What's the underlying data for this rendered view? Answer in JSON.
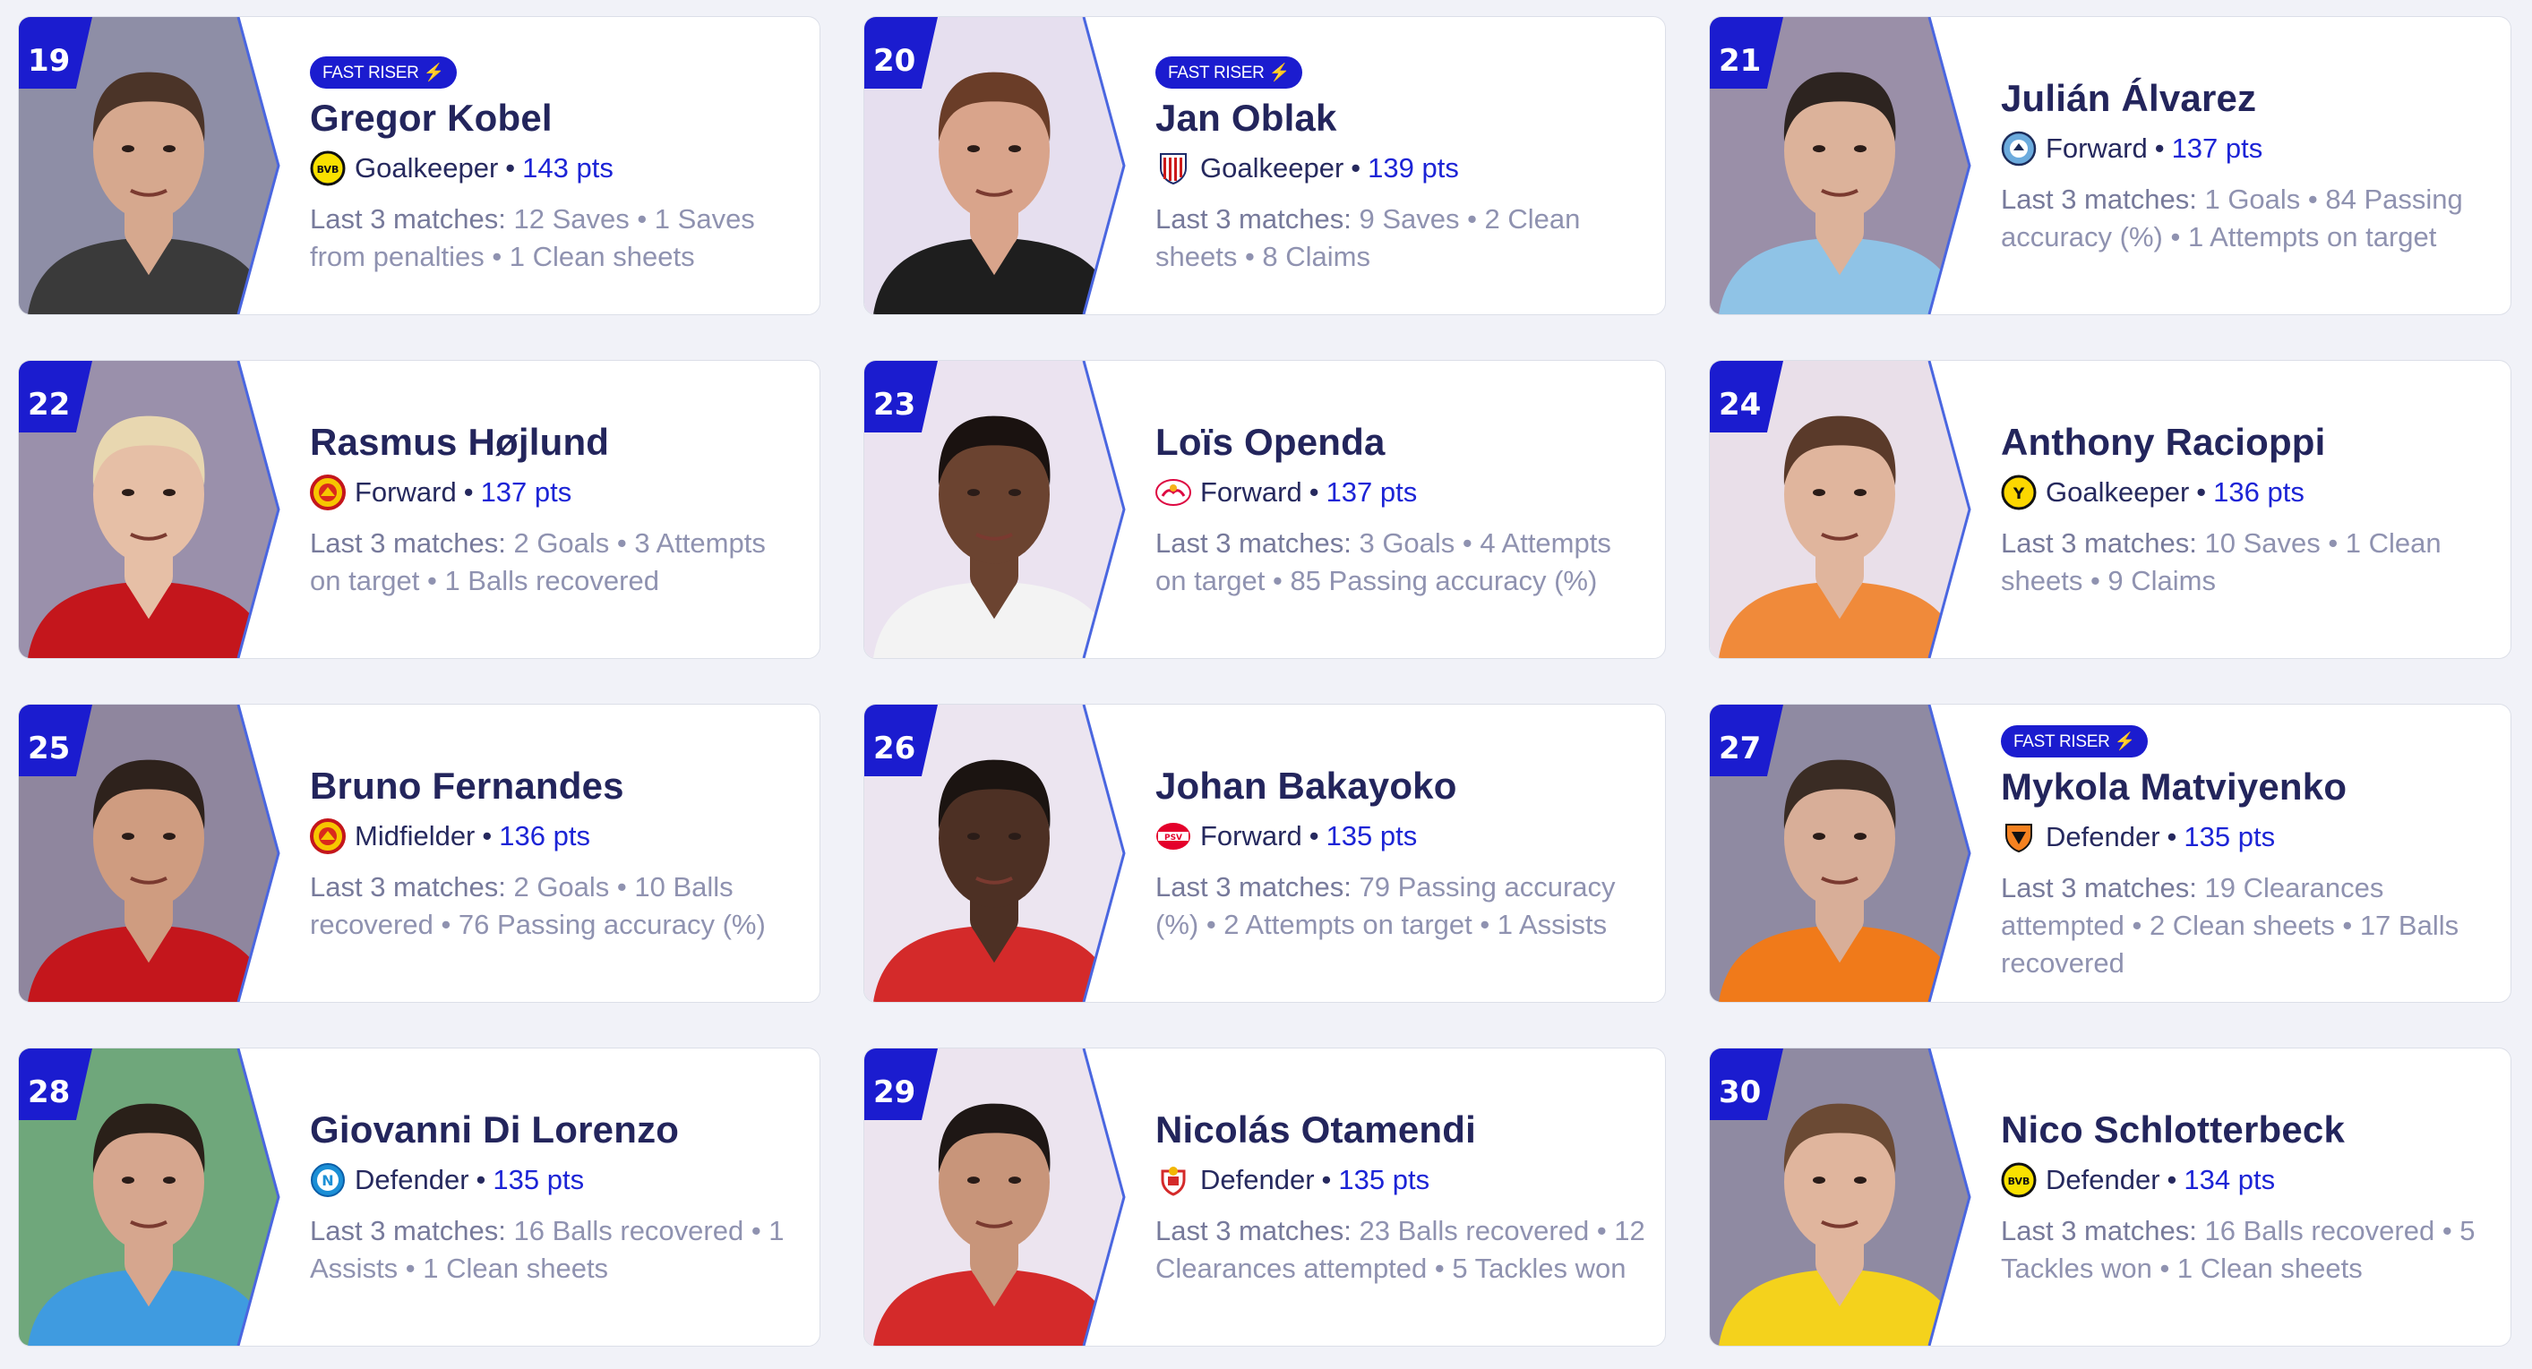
{
  "labels": {
    "fast_riser": "FAST RISER ⚡",
    "last3": "Last 3 matches:",
    "sep": " • "
  },
  "players": [
    {
      "rank": "19",
      "name": "Gregor Kobel",
      "position": "Goalkeeper",
      "pts": "143 pts",
      "fast": true,
      "club": "dortmund",
      "stats": "12 Saves • 1 Saves from penalties • 1 Clean sheets",
      "bg": "#8e8ea6",
      "skin": "#d6a88e",
      "hair": "#4b3428",
      "shirt": "#3a3a3a"
    },
    {
      "rank": "20",
      "name": "Jan Oblak",
      "position": "Goalkeeper",
      "pts": "139 pts",
      "fast": true,
      "club": "atletico",
      "stats": "9 Saves • 2 Clean sheets • 8 Claims",
      "bg": "#e6dfef",
      "skin": "#d9a48b",
      "hair": "#6a3d28",
      "shirt": "#1e1e1e"
    },
    {
      "rank": "21",
      "name": "Julián Álvarez",
      "position": "Forward",
      "pts": "137 pts",
      "fast": false,
      "club": "mancity",
      "stats": "1 Goals • 84 Passing accuracy (%) • 1 Attempts on target",
      "bg": "#9a8fa8",
      "skin": "#dcb29a",
      "hair": "#2d2420",
      "shirt": "#8fc3e6"
    },
    {
      "rank": "22",
      "name": "Rasmus Højlund",
      "position": "Forward",
      "pts": "137 pts",
      "fast": false,
      "club": "manutd",
      "stats": "2 Goals • 3 Attempts on target • 1 Balls recovered",
      "bg": "#9a90ab",
      "skin": "#e6bfa6",
      "hair": "#e8d7b0",
      "shirt": "#c4161c"
    },
    {
      "rank": "23",
      "name": "Loïs Openda",
      "position": "Forward",
      "pts": "137 pts",
      "fast": false,
      "club": "leipzig",
      "stats": "3 Goals • 4 Attempts on target • 85 Passing accuracy (%)",
      "bg": "#ebe3f0",
      "skin": "#6b4330",
      "hair": "#1a1210",
      "shirt": "#f3f3f3"
    },
    {
      "rank": "24",
      "name": "Anthony Racioppi",
      "position": "Goalkeeper",
      "pts": "136 pts",
      "fast": false,
      "club": "youngboys",
      "stats": "10 Saves • 1 Clean sheets • 9 Claims",
      "bg": "#e9dfe9",
      "skin": "#e0b59d",
      "hair": "#5a3a2a",
      "shirt": "#f08a3a"
    },
    {
      "rank": "25",
      "name": "Bruno Fernandes",
      "position": "Midfielder",
      "pts": "136 pts",
      "fast": false,
      "club": "manutd",
      "stats": "2 Goals • 10 Balls recovered • 76 Passing accuracy (%)",
      "bg": "#8f869e",
      "skin": "#cf9c80",
      "hair": "#2e221c",
      "shirt": "#c4161c"
    },
    {
      "rank": "26",
      "name": "Johan Bakayoko",
      "position": "Forward",
      "pts": "135 pts",
      "fast": false,
      "club": "psv",
      "stats": "79 Passing accuracy (%) • 2 Attempts on target • 1 Assists",
      "bg": "#ece5f0",
      "skin": "#4d3024",
      "hair": "#1b1411",
      "shirt": "#d42a2a"
    },
    {
      "rank": "27",
      "name": "Mykola Matviyenko",
      "position": "Defender",
      "pts": "135 pts",
      "fast": true,
      "club": "shakhtar",
      "stats": "19 Clearances attempted • 2 Clean sheets • 17 Balls recovered",
      "bg": "#8f8aa2",
      "skin": "#d8ae98",
      "hair": "#3a2c24",
      "shirt": "#f07a1a"
    },
    {
      "rank": "28",
      "name": "Giovanni Di Lorenzo",
      "position": "Defender",
      "pts": "135 pts",
      "fast": false,
      "club": "napoli",
      "stats": "16 Balls recovered • 1 Assists • 1 Clean sheets",
      "bg": "#6fa77b",
      "skin": "#d6a68e",
      "hair": "#2a2019",
      "shirt": "#3f9be0"
    },
    {
      "rank": "29",
      "name": "Nicolás Otamendi",
      "position": "Defender",
      "pts": "135 pts",
      "fast": false,
      "club": "benfica",
      "stats": "23 Balls recovered • 12 Clearances attempted • 5 Tackles won",
      "bg": "#ece4ef",
      "skin": "#c8957a",
      "hair": "#1e1715",
      "shirt": "#d42a2a"
    },
    {
      "rank": "30",
      "name": "Nico Schlotterbeck",
      "position": "Defender",
      "pts": "134 pts",
      "fast": false,
      "club": "dortmund",
      "stats": "16 Balls recovered • 5 Tackles won • 1 Clean sheets",
      "bg": "#8f8aa2",
      "skin": "#e0b59d",
      "hair": "#6b4a34",
      "shirt": "#f4d21c"
    }
  ]
}
